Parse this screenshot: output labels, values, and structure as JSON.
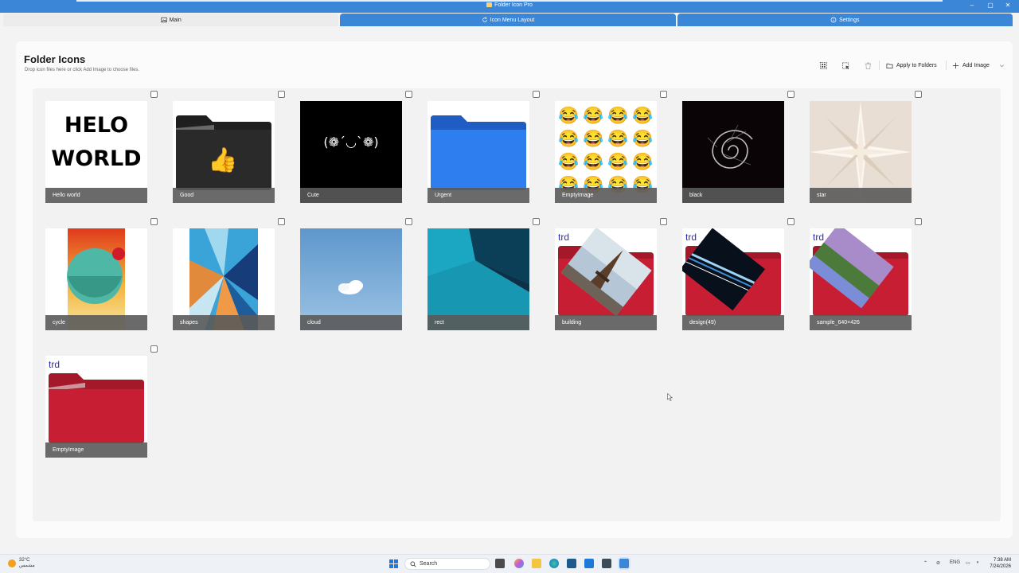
{
  "window": {
    "title": "Folder Icon Pro",
    "controls": [
      "–",
      "▢",
      "✕"
    ]
  },
  "tabs": [
    {
      "label": "Main",
      "icon": "image-icon",
      "active": true
    },
    {
      "label": "Icon Menu Layout",
      "icon": "refresh-icon",
      "active": false
    },
    {
      "label": "Settings",
      "icon": "info-icon",
      "active": false
    }
  ],
  "header": {
    "title": "Folder Icons",
    "subtitle": "Drop icon files here or click Add Image to choose files."
  },
  "toolbar": {
    "select_all_icon": "select-all-icon",
    "select_none_icon": "select-none-icon",
    "delete_icon": "trash-icon",
    "apply_label": "Apply to Folders",
    "add_label": "Add Image",
    "dropdown_icon": "chevron-down-icon"
  },
  "icons": [
    {
      "name": "Hello world",
      "image_text": [
        "HELO",
        "WORLD"
      ]
    },
    {
      "name": "Good",
      "image_text": [
        "👍"
      ]
    },
    {
      "name": "Cute",
      "image_text": [
        "(❁´◡`❁)"
      ]
    },
    {
      "name": "Urgent"
    },
    {
      "name": "EmptyImage",
      "image_text": [
        "😂"
      ]
    },
    {
      "name": "black"
    },
    {
      "name": "star"
    },
    {
      "name": "cycle"
    },
    {
      "name": "shapes"
    },
    {
      "name": "cloud"
    },
    {
      "name": "rect"
    },
    {
      "name": "building",
      "image_text": [
        "trd"
      ]
    },
    {
      "name": "design(49)",
      "image_text": [
        "trd"
      ]
    },
    {
      "name": "sample_640×426",
      "image_text": [
        "trd"
      ]
    },
    {
      "name": "EmptyImage",
      "image_text": [
        "trd"
      ]
    }
  ],
  "taskbar": {
    "weather_temp": "32°C",
    "weather_desc": "مشمس",
    "search_placeholder": "Search",
    "language": "ENG",
    "time": "7:38 AM",
    "date": "7/24/2026"
  },
  "colors": {
    "accent": "#3c86d8",
    "folder_red": "#c81e33",
    "folder_blue": "#2f7ef0"
  }
}
